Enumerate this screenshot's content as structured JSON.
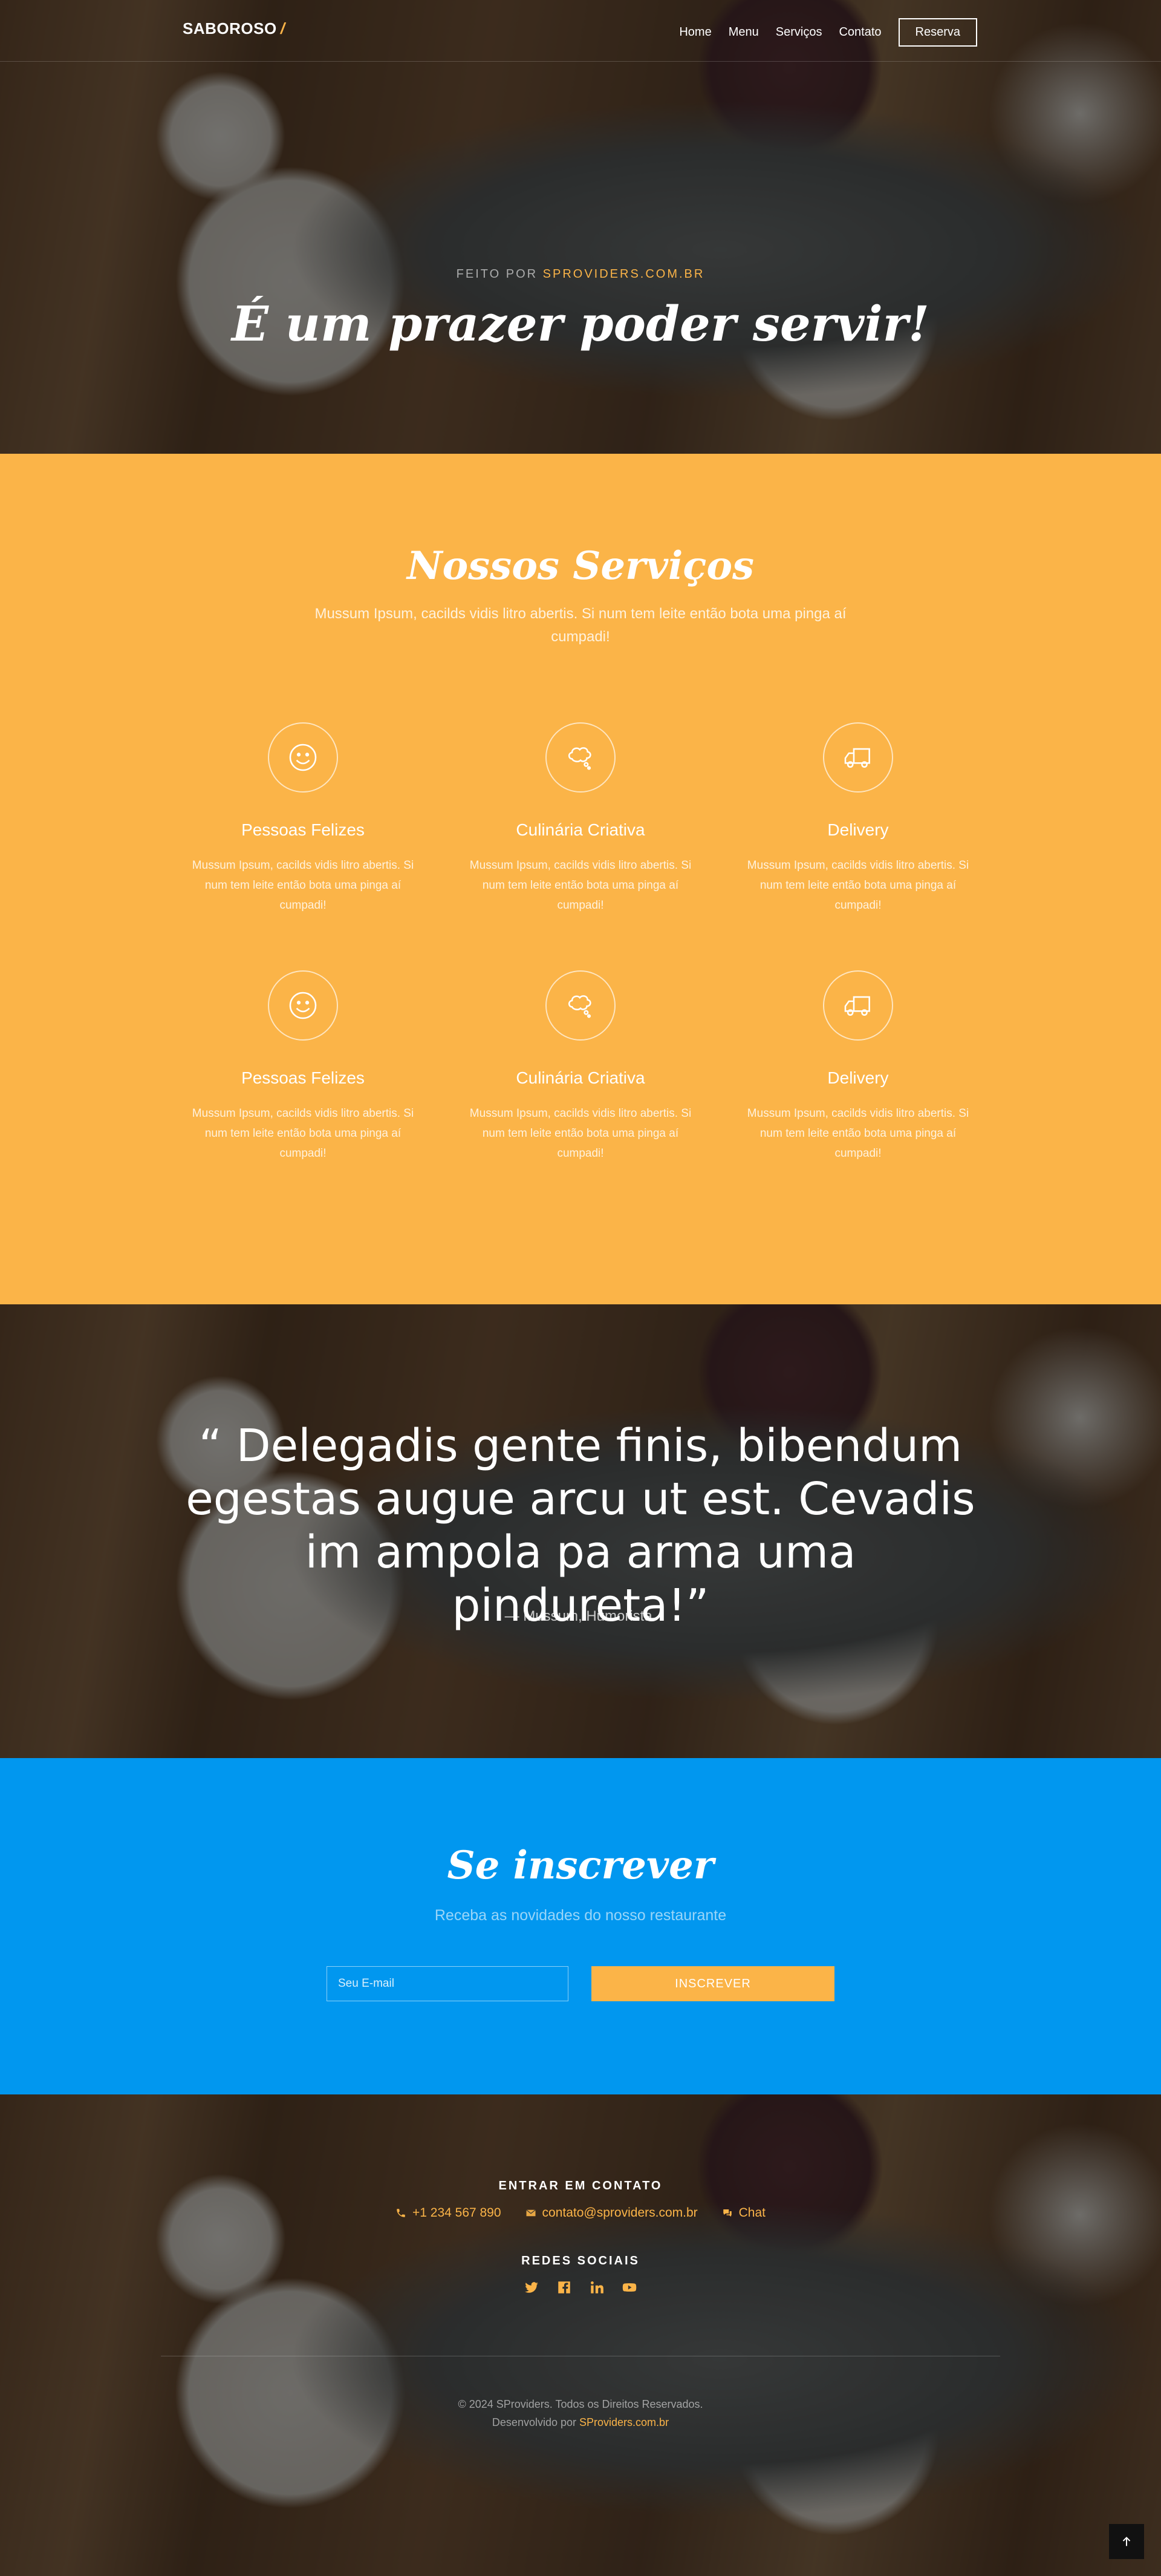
{
  "header": {
    "brand": "SABOROSO",
    "brand_mark": "/",
    "nav": [
      "Home",
      "Menu",
      "Serviços",
      "Contato"
    ],
    "reserve_label": "Reserva"
  },
  "hero": {
    "kicker_prefix": "FEITO POR ",
    "kicker_link": "SPROVIDERS.COM.BR",
    "title": "É um prazer poder servir!"
  },
  "services": {
    "title": "Nossos Serviços",
    "subtitle": "Mussum Ipsum, cacilds vidis litro abertis. Si num tem leite então bota uma pinga aí cumpadi!",
    "items": [
      {
        "title": "Pessoas Felizes",
        "text": "Mussum Ipsum, cacilds vidis litro abertis. Si num tem leite então bota uma pinga aí cumpadi!",
        "icon": "smile-icon"
      },
      {
        "title": "Culinária Criativa",
        "text": "Mussum Ipsum, cacilds vidis litro abertis. Si num tem leite então bota uma pinga aí cumpadi!",
        "icon": "thought-bubble-icon"
      },
      {
        "title": "Delivery",
        "text": "Mussum Ipsum, cacilds vidis litro abertis. Si num tem leite então bota uma pinga aí cumpadi!",
        "icon": "truck-icon"
      },
      {
        "title": "Pessoas Felizes",
        "text": "Mussum Ipsum, cacilds vidis litro abertis. Si num tem leite então bota uma pinga aí cumpadi!",
        "icon": "smile-icon"
      },
      {
        "title": "Culinária Criativa",
        "text": "Mussum Ipsum, cacilds vidis litro abertis. Si num tem leite então bota uma pinga aí cumpadi!",
        "icon": "thought-bubble-icon"
      },
      {
        "title": "Delivery",
        "text": "Mussum Ipsum, cacilds vidis litro abertis. Si num tem leite então bota uma pinga aí cumpadi!",
        "icon": "truck-icon"
      }
    ]
  },
  "quote": {
    "text": "“ Delegadis gente finis, bibendum egestas augue arcu ut est. Cevadis im ampola pa arma uma pindureta!”",
    "author": "— Mussum, Humorista."
  },
  "subscribe": {
    "title": "Se inscrever",
    "subtitle": "Receba as novidades do nosso restaurante",
    "email_placeholder": "Seu E-mail",
    "button_label": "INSCREVER"
  },
  "footer": {
    "contact_title": "ENTRAR EM CONTATO",
    "phone": "+1 234 567 890",
    "email": "contato@sproviders.com.br",
    "chat": "Chat",
    "social_title": "REDES SOCIAIS",
    "social_icons": [
      "twitter-icon",
      "facebook-icon",
      "linkedin-icon",
      "youtube-icon"
    ],
    "copyright": "© 2024 SProviders. Todos os Direitos Reservados.",
    "credit_prefix": "Desenvolvido por ",
    "credit_link": "SProviders.com.br"
  },
  "colors": {
    "accent": "#fbb448",
    "services_bg": "#fbb448",
    "subscribe_bg": "#0197ef"
  }
}
